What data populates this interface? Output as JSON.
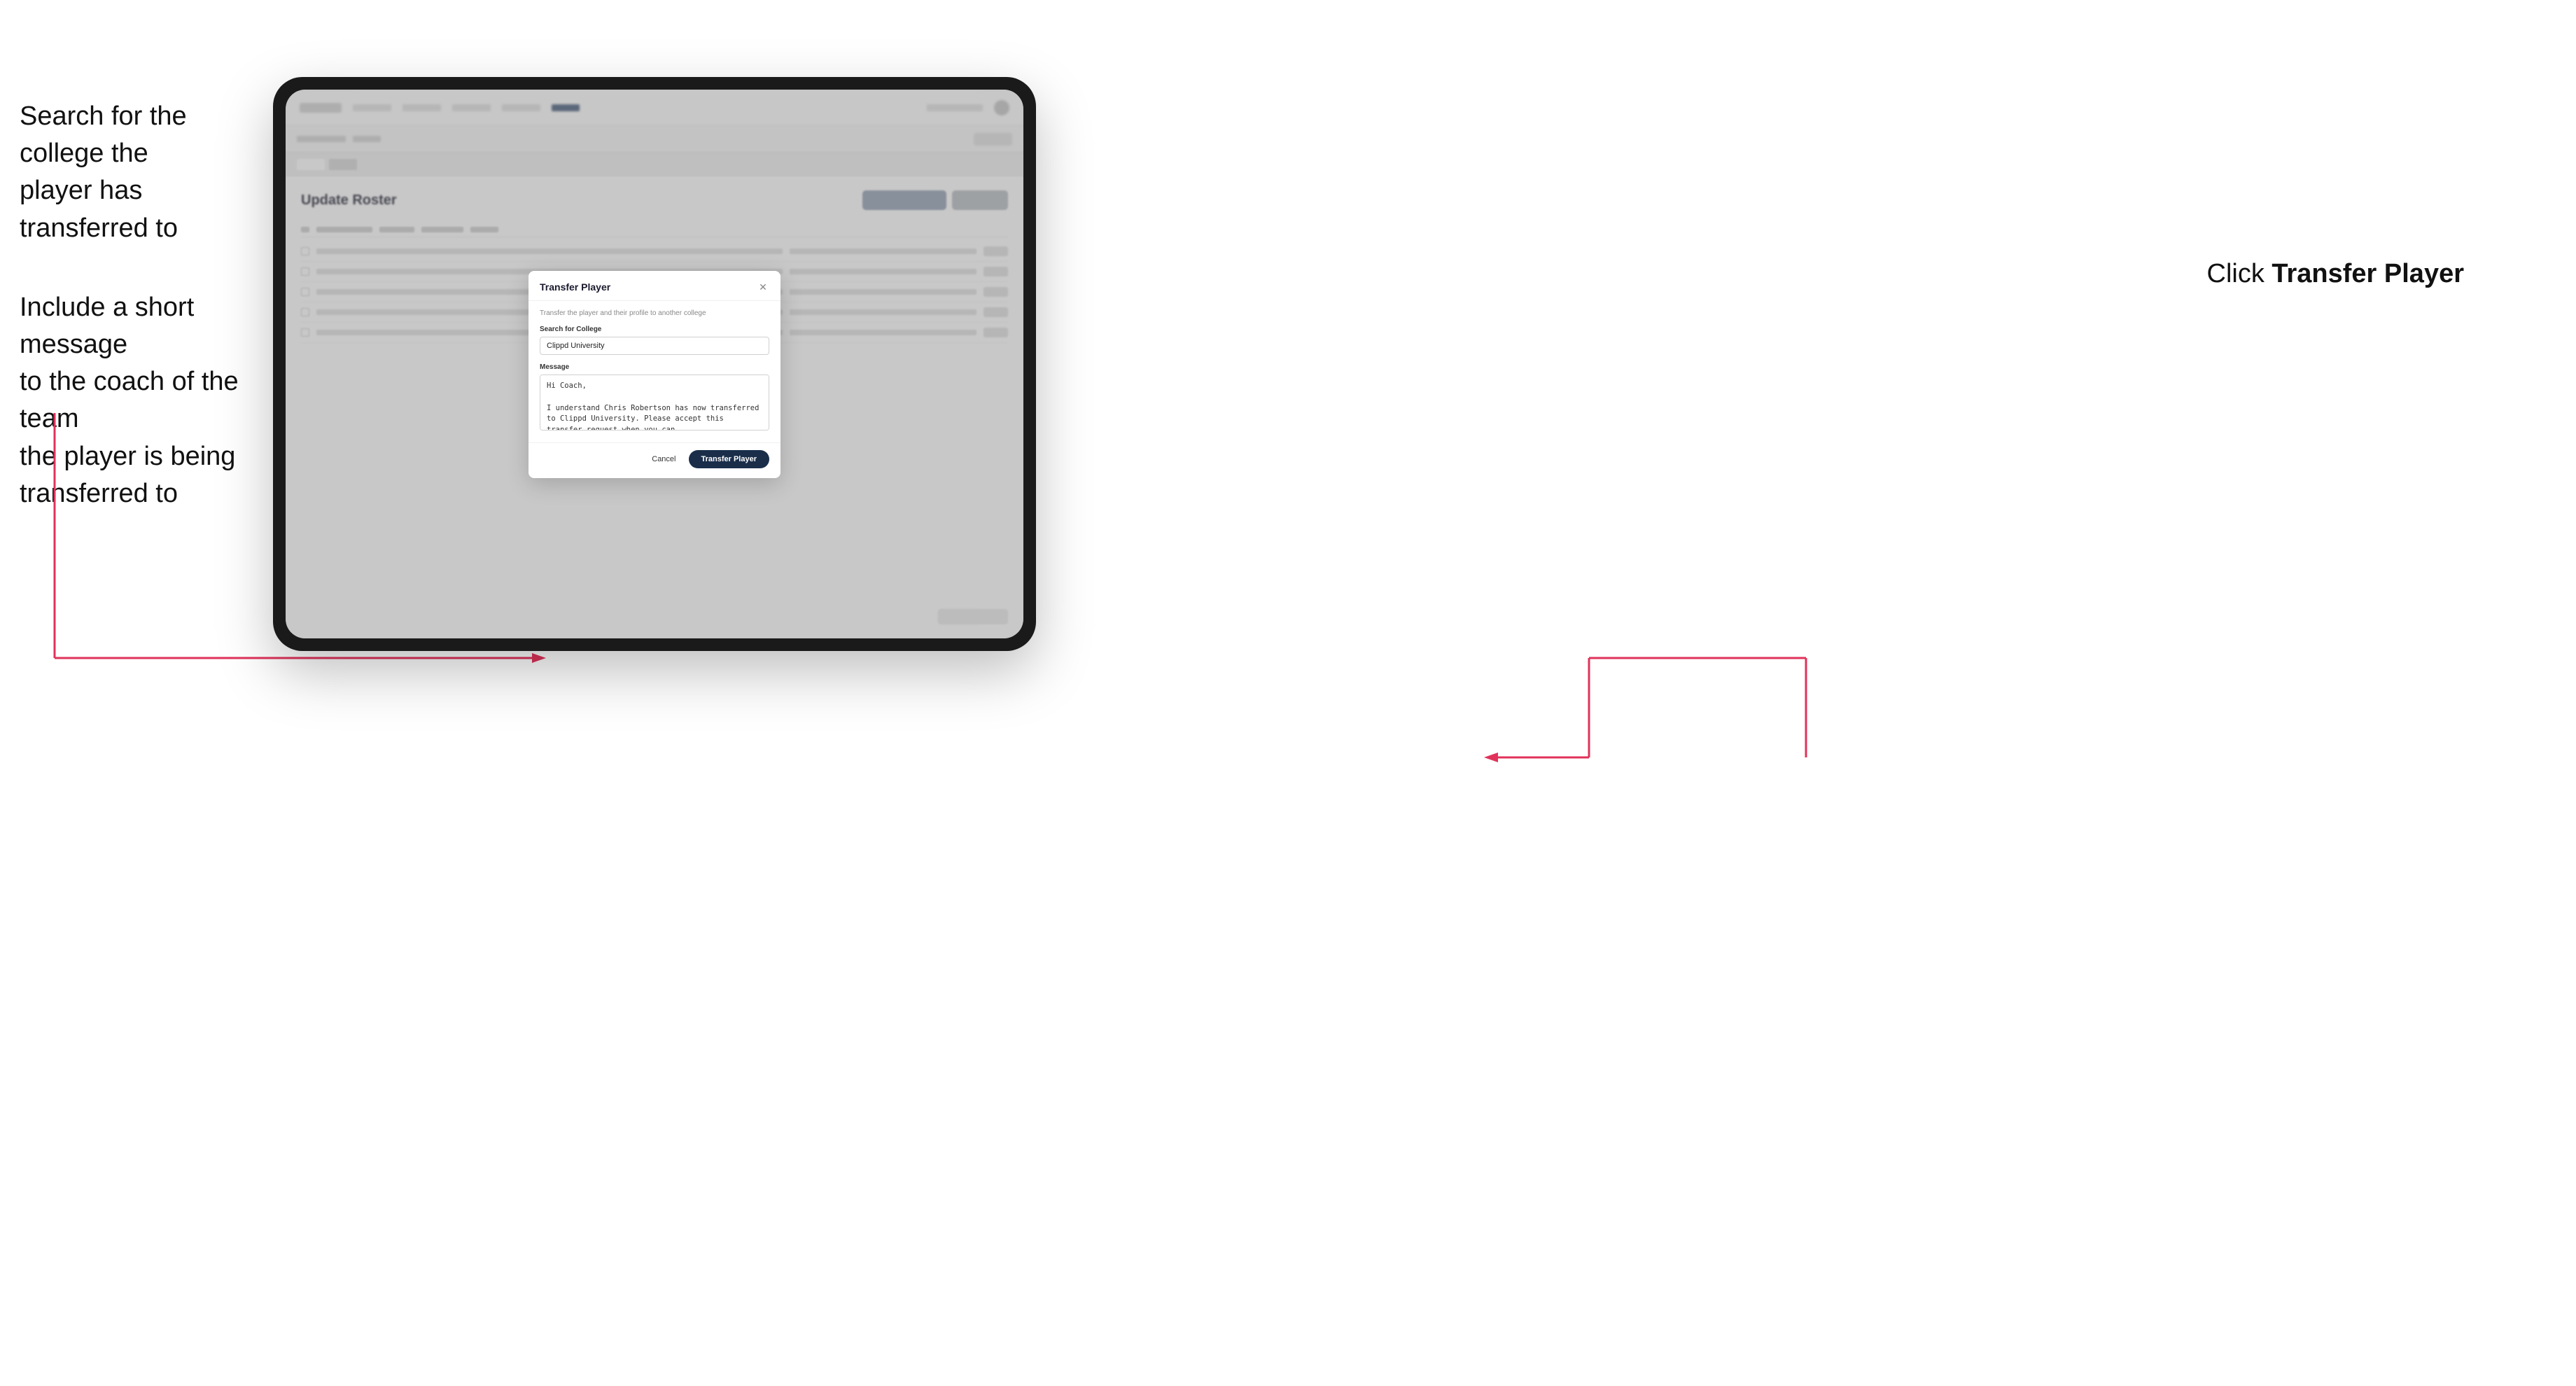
{
  "annotations": {
    "left": {
      "block1": "Search for the college the\nplayer has transferred to",
      "block2": "Include a short message\nto the coach of the team\nthe player is being\ntransferred to"
    },
    "right": {
      "prefix": "Click ",
      "bold": "Transfer Player"
    }
  },
  "dialog": {
    "title": "Transfer Player",
    "subtitle": "Transfer the player and their profile to another college",
    "search_label": "Search for College",
    "search_value": "Clippd University",
    "message_label": "Message",
    "message_value": "Hi Coach,\n\nI understand Chris Robertson has now transferred to Clippd University. Please accept this transfer request when you can.",
    "cancel_label": "Cancel",
    "transfer_label": "Transfer Player"
  },
  "page": {
    "title": "Update Roster"
  }
}
